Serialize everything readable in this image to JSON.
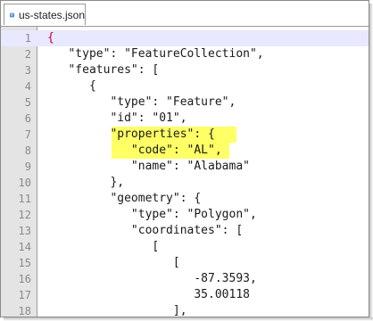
{
  "tab": {
    "label": "us-states.json",
    "icon": "json-file-icon"
  },
  "colors": {
    "gutter": "#e4e4e4",
    "highlight": "#ffff66",
    "current_line_text": "#c4003a",
    "current_line_bg": "#e8e8ff"
  },
  "editor": {
    "lines": [
      {
        "num": "1",
        "text": "{"
      },
      {
        "num": "2",
        "text": "   \"type\": \"FeatureCollection\","
      },
      {
        "num": "3",
        "text": "   \"features\": ["
      },
      {
        "num": "4",
        "text": "      {"
      },
      {
        "num": "5",
        "text": "         \"type\": \"Feature\","
      },
      {
        "num": "6",
        "text": "         \"id\": \"01\","
      },
      {
        "num": "7",
        "text": "         \"properties\": {"
      },
      {
        "num": "8",
        "text": "            \"code\": \"AL\","
      },
      {
        "num": "9",
        "text": "            \"name\": \"Alabama\""
      },
      {
        "num": "10",
        "text": "         },"
      },
      {
        "num": "11",
        "text": "         \"geometry\": {"
      },
      {
        "num": "12",
        "text": "            \"type\": \"Polygon\","
      },
      {
        "num": "13",
        "text": "            \"coordinates\": ["
      },
      {
        "num": "14",
        "text": "               ["
      },
      {
        "num": "15",
        "text": "                  ["
      },
      {
        "num": "16",
        "text": "                     -87.3593,"
      },
      {
        "num": "17",
        "text": "                     35.00118"
      },
      {
        "num": "18",
        "text": "                  ],"
      }
    ]
  }
}
